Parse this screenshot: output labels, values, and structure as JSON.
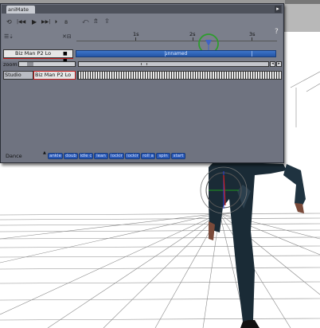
{
  "window": {
    "tab_label": "aniMate",
    "title_arrow": "▸"
  },
  "transport": {
    "loop_icon": "⟲",
    "rewind_to_start": "|◀◀",
    "play": "▶",
    "end": "▶▶|",
    "step": "⏵",
    "frame_value": "8"
  },
  "ruler": {
    "labels": [
      "1s",
      "2s",
      "3s"
    ]
  },
  "track": {
    "name": "Biz Man P2 Lo",
    "block_label": "unnamed"
  },
  "zoom": {
    "label": "zoom"
  },
  "studio": {
    "label": "Studio",
    "figure": "Biz Man P2 Lo"
  },
  "library": {
    "category": "Dance",
    "buttons": [
      "ankle",
      "doub",
      "idle c",
      "lean",
      "lockir",
      "lockir",
      "roll a",
      "spin",
      "start"
    ]
  },
  "help": "?",
  "colors": {
    "window_bg": "#6f7380",
    "block_blue": "#2456a6",
    "selection_red": "#c41d1d",
    "marker_green": "#2e9c2e",
    "suit": "#1a2b36"
  }
}
